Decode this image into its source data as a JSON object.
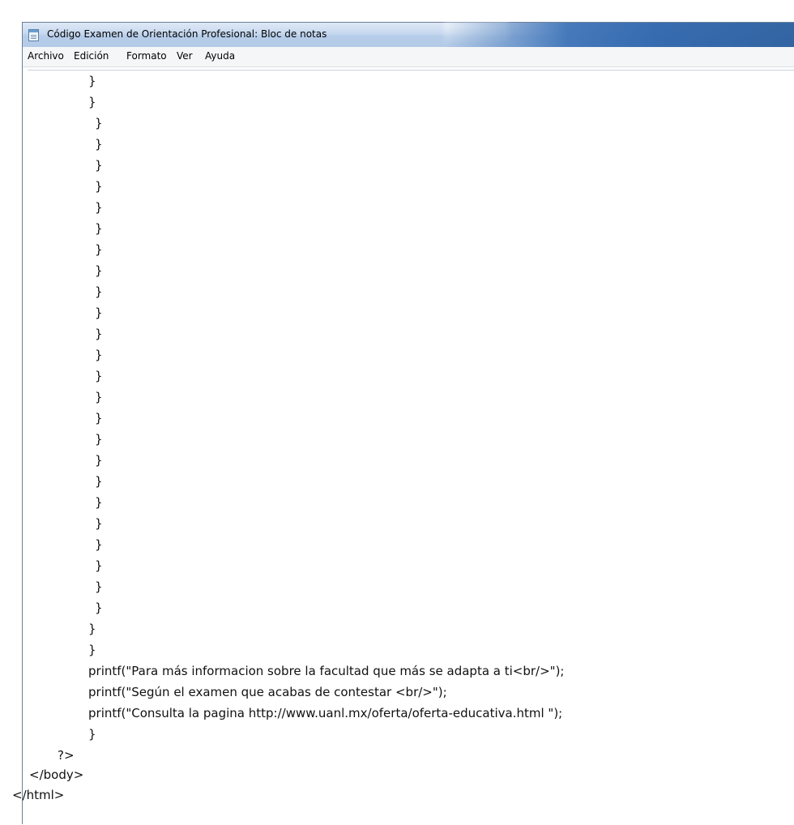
{
  "window": {
    "title": "Código Examen de Orientación Profesional: Bloc de notas"
  },
  "menu": {
    "items": [
      "Archivo",
      "Edición",
      "Formato",
      "Ver",
      "Ayuda"
    ]
  },
  "editor": {
    "lines": [
      "}",
      "}",
      "}",
      "}",
      "}",
      "}",
      "}",
      "}",
      "}",
      "}",
      "}",
      "}",
      "}",
      "}",
      "}",
      "}",
      "}",
      "}",
      "}",
      "}",
      "}",
      "}",
      "}",
      "}",
      "}",
      "}",
      "}",
      "}",
      "printf(\"Para más informacion sobre la facultad que más se adapta a ti<br/>\");",
      "printf(\"Según el examen que acabas de contestar <br/>\");",
      "printf(\"Consulta la pagina http://www.uanl.mx/oferta/oferta-educativa.html \");",
      "}",
      "?>",
      "</body>",
      "</html>"
    ]
  }
}
